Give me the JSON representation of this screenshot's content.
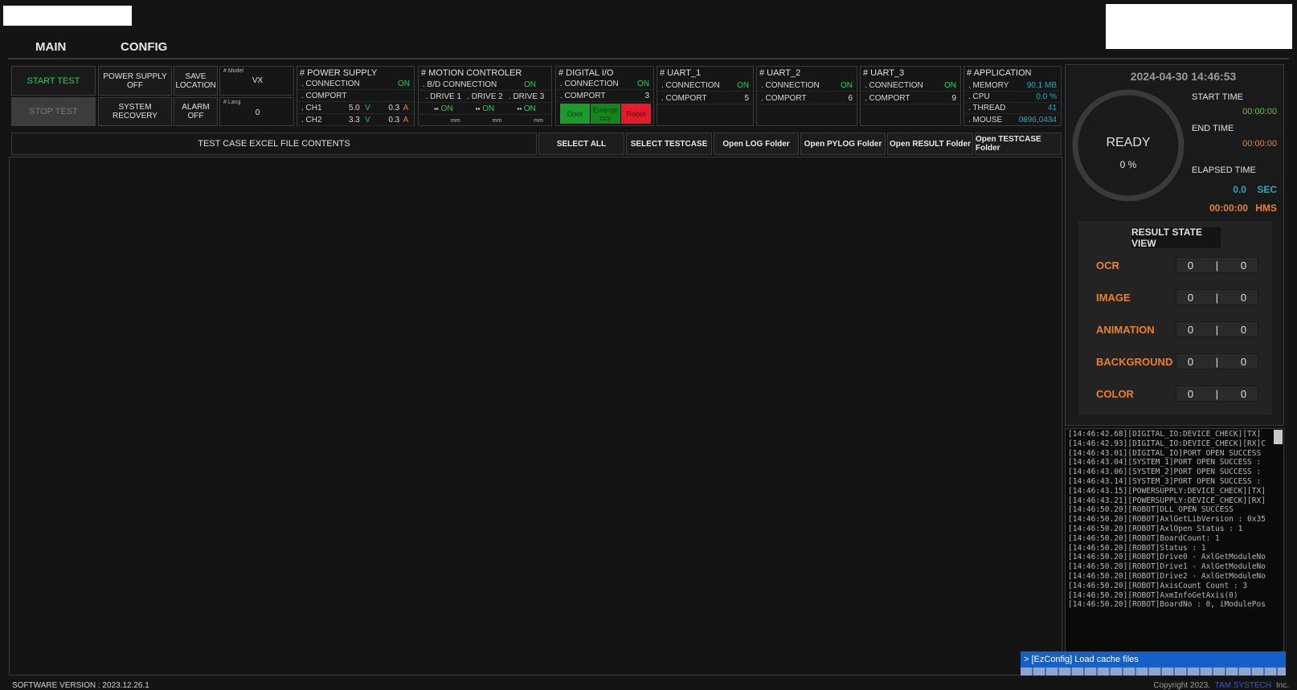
{
  "tabs": [
    {
      "label": "MAIN"
    },
    {
      "label": "CONFIG"
    }
  ],
  "controls": {
    "start_test": "START TEST",
    "stop_test": "STOP TEST",
    "power_supply_off": "POWER SUPPLY OFF",
    "system_recovery": "SYSTEM RECOVERY",
    "save_location": "SAVE LOCATION",
    "alarm_off": "ALARM OFF",
    "model_label": "# Model",
    "model_value": "VX",
    "lang_label": "# Lang",
    "lang_value": "0"
  },
  "power_supply": {
    "title": "# POWER SUPPLY",
    "connection_label": ". CONNECTION",
    "connection_value": "ON",
    "comport_label": ". COMPORT",
    "ch1_label": ". CH1",
    "ch1_v": "5.0",
    "ch1_v_unit": "V",
    "ch1_a": "0.3",
    "ch1_a_unit": "A",
    "ch2_label": ". CH2",
    "ch2_v": "3.3",
    "ch2_v_unit": "V",
    "ch2_a": "0.3",
    "ch2_a_unit": "A"
  },
  "motion": {
    "title": "# MOTION CONTROLER",
    "bd_label": ". B/D CONNECTION",
    "bd_value": "ON",
    "drive1": ". DRIVE 1",
    "drive2": ". DRIVE 2",
    "drive3": ". DRIVE 3",
    "d1_status": "ON",
    "d2_status": "ON",
    "d3_status": "ON",
    "d1_unit": "mm",
    "d2_unit": "mm",
    "d3_unit": "mm"
  },
  "digital_io": {
    "title": "# DIGITAL I/O",
    "connection_label": ". CONNECTION",
    "connection_value": "ON",
    "comport_label": ". COMPORT",
    "comport_value": "3",
    "door": "Door",
    "emergency": "Emerge ncy",
    "robot": "Robot"
  },
  "uart1": {
    "title": "# UART_1",
    "connection_label": ". CONNECTION",
    "connection_value": "ON",
    "comport_label": ". COMPORT",
    "comport_value": "5"
  },
  "uart2": {
    "title": "# UART_2",
    "connection_label": ". CONNECTION",
    "connection_value": "ON",
    "comport_label": ". COMPORT",
    "comport_value": "6"
  },
  "uart3": {
    "title": "# UART_3",
    "connection_label": ". CONNECTION",
    "connection_value": "ON",
    "comport_label": ". COMPORT",
    "comport_value": "9"
  },
  "application": {
    "title": "# APPLICATION",
    "memory_label": ". MEMORY",
    "memory_value": "90.1 MB",
    "cpu_label": ". CPU",
    "cpu_value": "0.0 %",
    "thread_label": ". THREAD",
    "thread_value": "41",
    "mouse_label": ". MOUSE",
    "mouse_value": "0896,0434"
  },
  "toolbar": {
    "excel_contents": "TEST CASE EXCEL FILE CONTENTS",
    "select_all": "SELECT ALL",
    "select_testcase": "SELECT TESTCASE",
    "open_log": "Open LOG Folder",
    "open_pylog": "Open PYLOG Folder",
    "open_result": "Open RESULT Folder",
    "open_testcase": "Open TESTCASE Folder"
  },
  "status": {
    "datetime": "2024-04-30  14:46:53",
    "state": "READY",
    "percent": "0 %",
    "start_time_label": "START TIME",
    "start_time_value": "00:00:00",
    "end_time_label": "END TIME",
    "end_time_value": "00:00:00",
    "elapsed_label": "ELAPSED TIME",
    "elapsed_sec_value": "0.0",
    "elapsed_sec_unit": "SEC",
    "elapsed_hms_value": "00:00:00",
    "elapsed_hms_unit": "HMS"
  },
  "results": {
    "title": "RESULT STATE VIEW",
    "rows": [
      {
        "name": "OCR",
        "left": "0",
        "sep": "|",
        "right": "0"
      },
      {
        "name": "IMAGE",
        "left": "0",
        "sep": "|",
        "right": "0"
      },
      {
        "name": "ANIMATION",
        "left": "0",
        "sep": "|",
        "right": "0"
      },
      {
        "name": "BACKGROUND",
        "left": "0",
        "sep": "|",
        "right": "0"
      },
      {
        "name": "COLOR",
        "left": "0",
        "sep": "|",
        "right": "0"
      }
    ]
  },
  "log": [
    "[14:46:42.68][DIGITAL_IO:DEVICE_CHECK][TX]",
    "[14:46:42.93][DIGITAL_IO:DEVICE_CHECK][RX]C",
    "[14:46:43.01][DIGITAL_IO]PORT OPEN SUCCESS",
    "[14:46:43.04][SYSTEM_1]PORT OPEN SUCCESS :",
    "[14:46:43.06][SYSTEM_2]PORT OPEN SUCCESS :",
    "[14:46:43.14][SYSTEM_3]PORT OPEN SUCCESS :",
    "[14:46:43.15][POWERSUPPLY:DEVICE_CHECK][TX]",
    "[14:46:43.21][POWERSUPPLY:DEVICE_CHECK][RX]",
    "[14:46:50.20][ROBOT]DLL OPEN SUCCESS",
    "[14:46:50.20][ROBOT]AxlGetLibVersion : 0x35",
    "[14:46:50.20][ROBOT]AxlOpen Status : 1",
    "[14:46:50.20][ROBOT]BoardCount: 1",
    "[14:46:50.20][ROBOT]Status : 1",
    "[14:46:50.20][ROBOT]Drive0 - AxlGetModuleNo",
    "[14:46:50.20][ROBOT]Drive1 - AxlGetModuleNo",
    "[14:46:50.20][ROBOT]Drive2 - AxlGetModuleNo",
    "[14:46:50.20][ROBOT]AxisCount Count : 3",
    "[14:46:50.20][ROBOT]AxmInfoGetAxis(0)",
    "[14:46:50.20][ROBOT]BoardNo : 0, iModulePos"
  ],
  "console": "> [EzConfig] Load cache files",
  "footer": {
    "version": "SOFTWARE VERSION : 2023.12.26.1",
    "copyright": "Copyright 2023.",
    "company": "TAM SYSTECH",
    "suffix": "Inc."
  },
  "colors": {
    "green_on": "#19d45a",
    "cyan": "#22aabb",
    "orange": "#e8822a",
    "door_green": "#1c9b2c",
    "emergency_green": "#16841f",
    "robot_red": "#e8192a",
    "console_blue": "#1560c8"
  }
}
